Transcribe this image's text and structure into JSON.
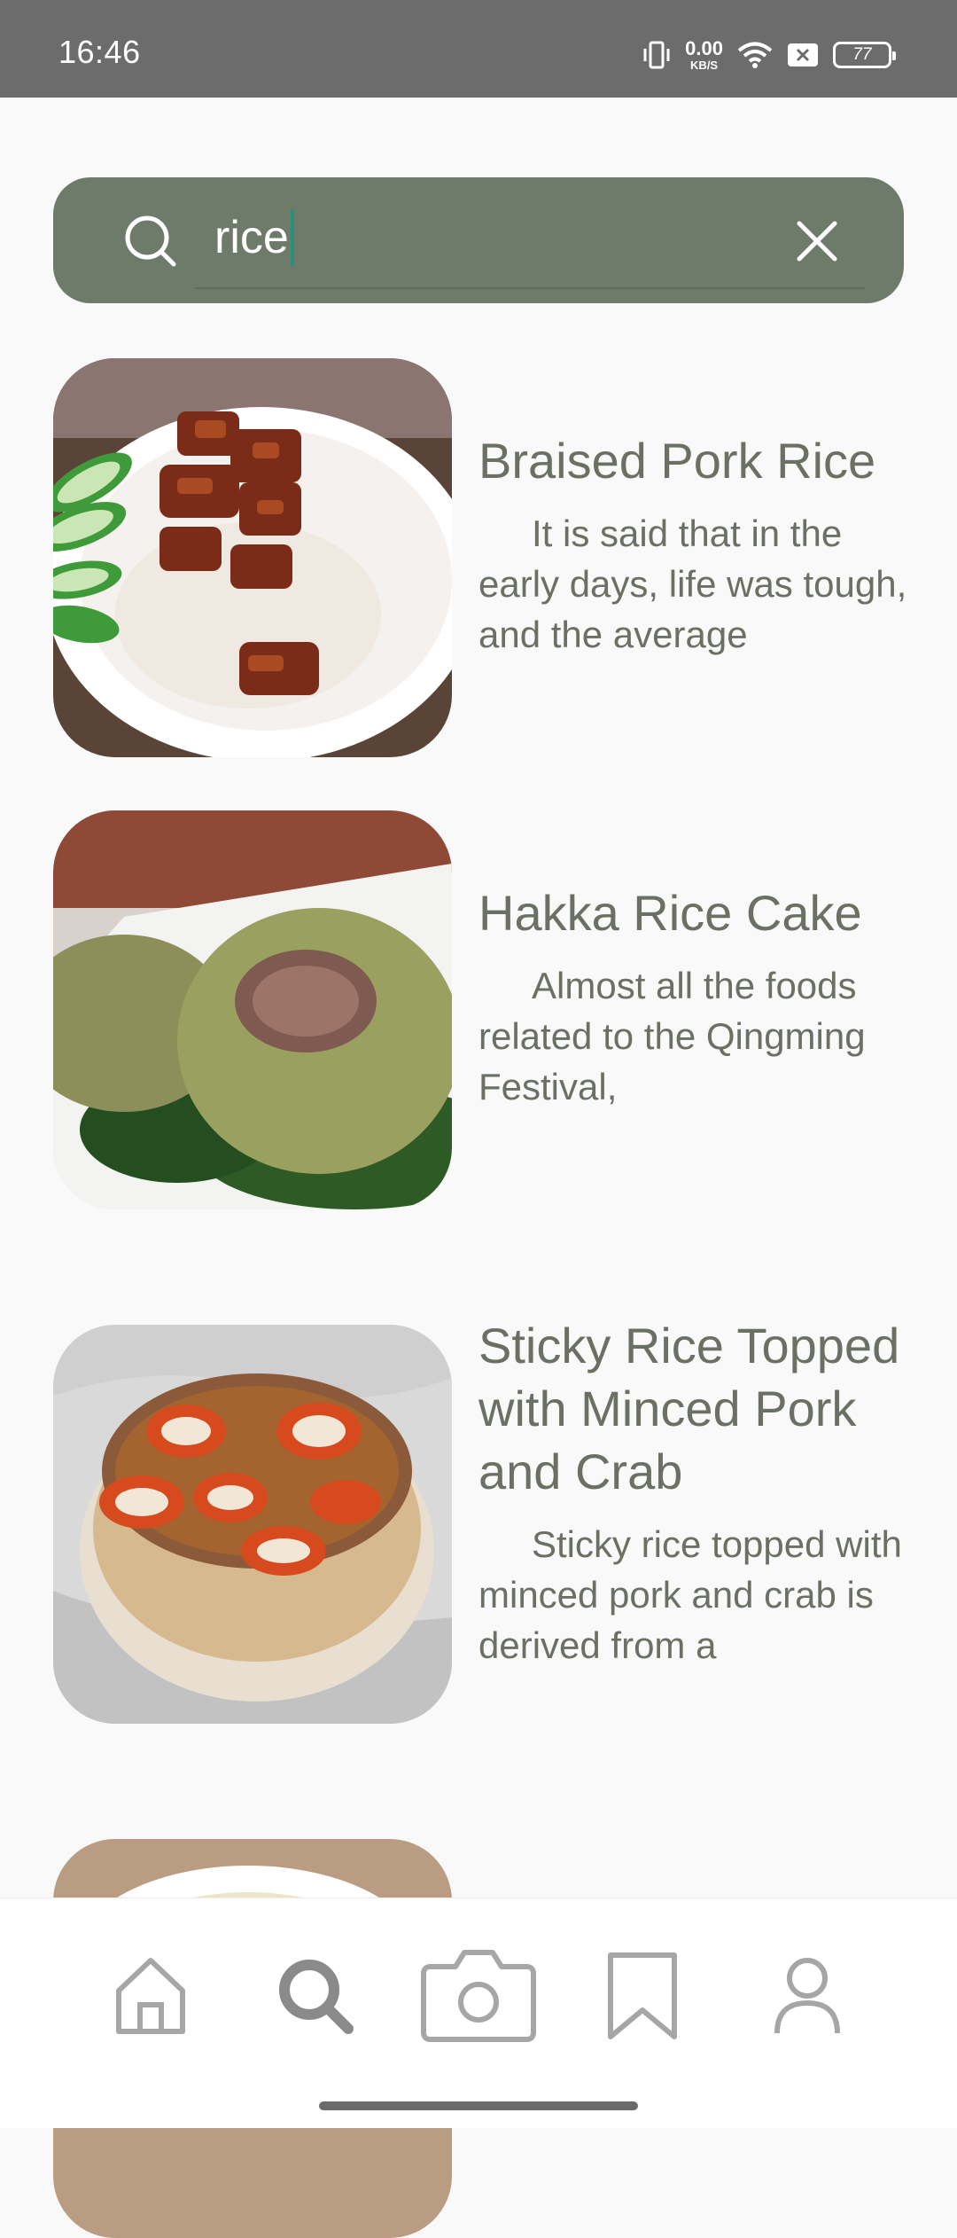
{
  "status_bar": {
    "time": "16:46",
    "net_speed_value": "0.00",
    "net_speed_unit": "KB/S",
    "battery": "77"
  },
  "search": {
    "query": "rice",
    "icon": "search-icon",
    "clear_icon": "close-icon"
  },
  "results": [
    {
      "title": "Braised Pork Rice",
      "description": "It is said that in the early days, life was tough, and the average"
    },
    {
      "title": "Hakka Rice Cake",
      "description": "Almost all the foods related to the Qingming Festival,"
    },
    {
      "title": "Sticky Rice Topped with Minced Pork and Crab",
      "description": "Sticky rice topped with minced pork and crab is derived from a"
    },
    {
      "title": "",
      "description": ""
    }
  ],
  "bottom_nav": [
    {
      "icon": "home-icon"
    },
    {
      "icon": "search-icon"
    },
    {
      "icon": "camera-icon"
    },
    {
      "icon": "bookmark-icon"
    },
    {
      "icon": "profile-icon"
    }
  ],
  "colors": {
    "search_bar": "#6e7b6b",
    "text": "#6a7064",
    "caret": "#2a8f7a",
    "status_bar": "#6c6c6c"
  }
}
